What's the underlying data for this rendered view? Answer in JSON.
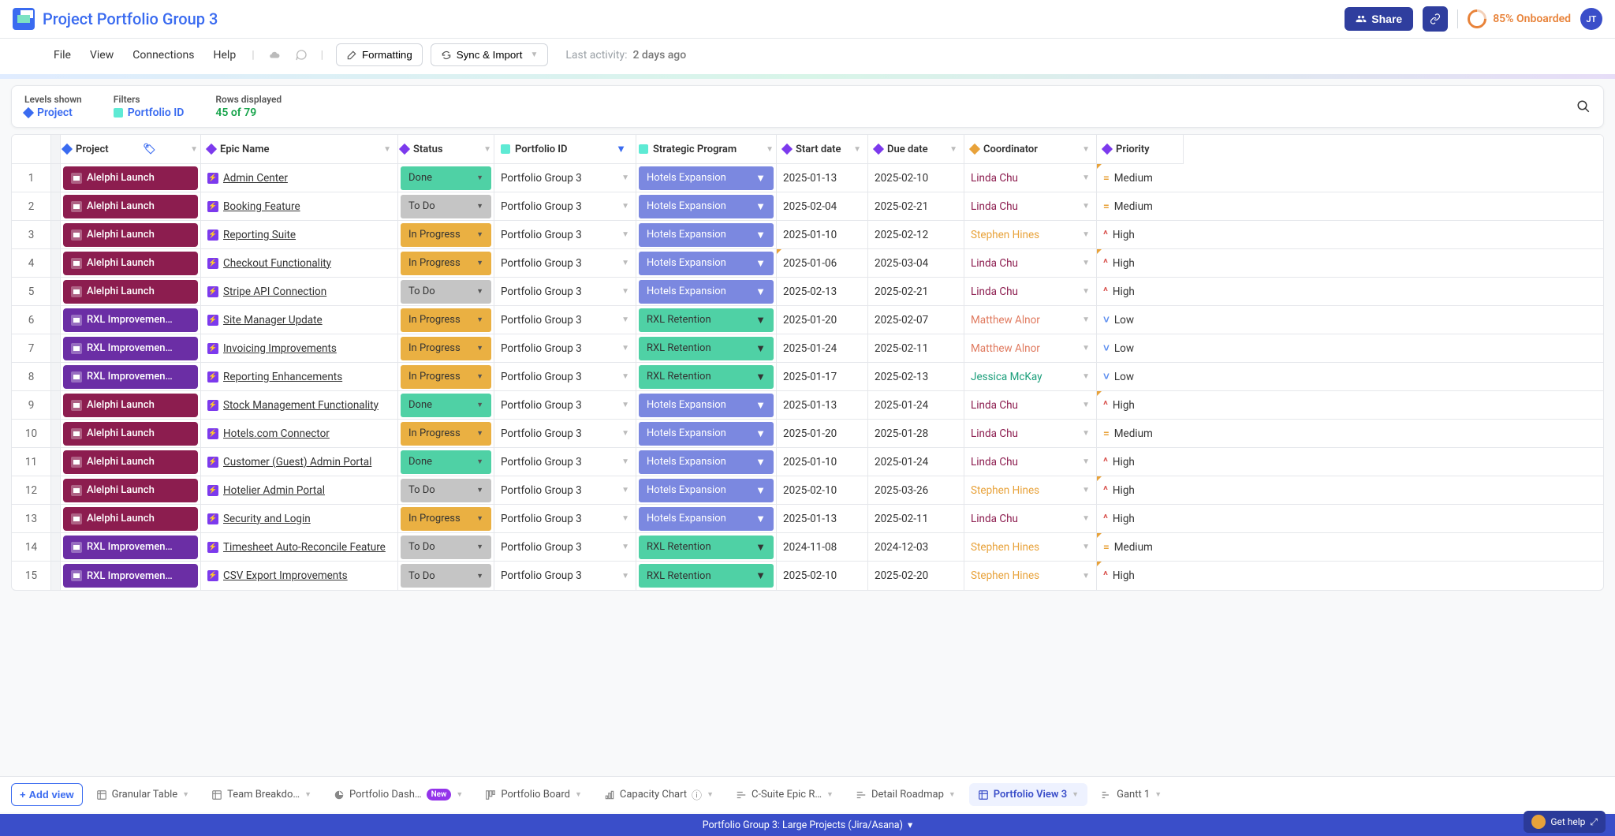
{
  "header": {
    "title": "Project Portfolio Group 3",
    "share_label": "Share",
    "onboard_label": "85% Onboarded",
    "avatar": "JT"
  },
  "menubar": {
    "file": "File",
    "view": "View",
    "connections": "Connections",
    "help": "Help",
    "formatting": "Formatting",
    "sync": "Sync & Import",
    "activity_prefix": "Last activity:",
    "activity_value": "2 days ago"
  },
  "infobar": {
    "levels_label": "Levels shown",
    "levels_value": "Project",
    "filters_label": "Filters",
    "filters_value": "Portfolio ID",
    "rows_label": "Rows displayed",
    "rows_value": "45 of 79"
  },
  "columns": {
    "project": "Project",
    "epic": "Epic Name",
    "status": "Status",
    "portfolio": "Portfolio ID",
    "strategic": "Strategic Program",
    "start": "Start date",
    "due": "Due date",
    "coord": "Coordinator",
    "prio": "Priority"
  },
  "rows": [
    {
      "n": 1,
      "project": "Alelphi Launch",
      "projType": "alelphi",
      "epic": "Admin Center",
      "status": "Done",
      "portfolio": "Portfolio Group 3",
      "strategic": "Hotels Expansion",
      "stratType": "hotels",
      "start": "2025-01-13",
      "due": "2025-02-10",
      "coord": "Linda Chu",
      "coordType": "linda",
      "prio": "Medium",
      "startMark": false,
      "prioMark": true
    },
    {
      "n": 2,
      "project": "Alelphi Launch",
      "projType": "alelphi",
      "epic": "Booking Feature",
      "status": "To Do",
      "portfolio": "Portfolio Group 3",
      "strategic": "Hotels Expansion",
      "stratType": "hotels",
      "start": "2025-02-04",
      "due": "2025-02-21",
      "coord": "Linda Chu",
      "coordType": "linda",
      "prio": "Medium",
      "startMark": false,
      "prioMark": false
    },
    {
      "n": 3,
      "project": "Alelphi Launch",
      "projType": "alelphi",
      "epic": "Reporting Suite",
      "status": "In Progress",
      "portfolio": "Portfolio Group 3",
      "strategic": "Hotels Expansion",
      "stratType": "hotels",
      "start": "2025-01-10",
      "due": "2025-02-12",
      "coord": "Stephen Hines",
      "coordType": "stephen",
      "prio": "High",
      "startMark": false,
      "prioMark": false
    },
    {
      "n": 4,
      "project": "Alelphi Launch",
      "projType": "alelphi",
      "epic": "Checkout Functionality",
      "status": "In Progress",
      "portfolio": "Portfolio Group 3",
      "strategic": "Hotels Expansion",
      "stratType": "hotels",
      "start": "2025-01-06",
      "due": "2025-03-04",
      "coord": "Linda Chu",
      "coordType": "linda",
      "prio": "High",
      "startMark": true,
      "prioMark": true
    },
    {
      "n": 5,
      "project": "Alelphi Launch",
      "projType": "alelphi",
      "epic": "Stripe API Connection",
      "status": "To Do",
      "portfolio": "Portfolio Group 3",
      "strategic": "Hotels Expansion",
      "stratType": "hotels",
      "start": "2025-02-13",
      "due": "2025-02-21",
      "coord": "Linda Chu",
      "coordType": "linda",
      "prio": "High",
      "startMark": false,
      "prioMark": false
    },
    {
      "n": 6,
      "project": "RXL Improvemen…",
      "projType": "rxl",
      "epic": "Site Manager Update",
      "status": "In Progress",
      "portfolio": "Portfolio Group 3",
      "strategic": "RXL Retention",
      "stratType": "rxl",
      "start": "2025-01-20",
      "due": "2025-02-07",
      "coord": "Matthew Alnor",
      "coordType": "matthew",
      "prio": "Low",
      "startMark": false,
      "prioMark": false
    },
    {
      "n": 7,
      "project": "RXL Improvemen…",
      "projType": "rxl",
      "epic": "Invoicing Improvements",
      "status": "In Progress",
      "portfolio": "Portfolio Group 3",
      "strategic": "RXL Retention",
      "stratType": "rxl",
      "start": "2025-01-24",
      "due": "2025-02-11",
      "coord": "Matthew Alnor",
      "coordType": "matthew",
      "prio": "Low",
      "startMark": false,
      "prioMark": false
    },
    {
      "n": 8,
      "project": "RXL Improvemen…",
      "projType": "rxl",
      "epic": "Reporting Enhancements",
      "status": "In Progress",
      "portfolio": "Portfolio Group 3",
      "strategic": "RXL Retention",
      "stratType": "rxl",
      "start": "2025-01-17",
      "due": "2025-02-13",
      "coord": "Jessica McKay",
      "coordType": "jessica",
      "prio": "Low",
      "startMark": false,
      "prioMark": false
    },
    {
      "n": 9,
      "project": "Alelphi Launch",
      "projType": "alelphi",
      "epic": "Stock Management Functionality",
      "status": "Done",
      "portfolio": "Portfolio Group 3",
      "strategic": "Hotels Expansion",
      "stratType": "hotels",
      "start": "2025-01-13",
      "due": "2025-01-24",
      "coord": "Linda Chu",
      "coordType": "linda",
      "prio": "High",
      "startMark": false,
      "prioMark": true
    },
    {
      "n": 10,
      "project": "Alelphi Launch",
      "projType": "alelphi",
      "epic": "Hotels.com Connector",
      "status": "In Progress",
      "portfolio": "Portfolio Group 3",
      "strategic": "Hotels Expansion",
      "stratType": "hotels",
      "start": "2025-01-20",
      "due": "2025-01-28",
      "coord": "Linda Chu",
      "coordType": "linda",
      "prio": "Medium",
      "startMark": false,
      "prioMark": false
    },
    {
      "n": 11,
      "project": "Alelphi Launch",
      "projType": "alelphi",
      "epic": "Customer (Guest) Admin Portal",
      "status": "Done",
      "portfolio": "Portfolio Group 3",
      "strategic": "Hotels Expansion",
      "stratType": "hotels",
      "start": "2025-01-10",
      "due": "2025-01-24",
      "coord": "Linda Chu",
      "coordType": "linda",
      "prio": "High",
      "startMark": false,
      "prioMark": false
    },
    {
      "n": 12,
      "project": "Alelphi Launch",
      "projType": "alelphi",
      "epic": "Hotelier Admin Portal",
      "status": "To Do",
      "portfolio": "Portfolio Group 3",
      "strategic": "Hotels Expansion",
      "stratType": "hotels",
      "start": "2025-02-10",
      "due": "2025-03-26",
      "coord": "Stephen Hines",
      "coordType": "stephen",
      "prio": "High",
      "startMark": false,
      "prioMark": true
    },
    {
      "n": 13,
      "project": "Alelphi Launch",
      "projType": "alelphi",
      "epic": "Security and Login",
      "status": "In Progress",
      "portfolio": "Portfolio Group 3",
      "strategic": "Hotels Expansion",
      "stratType": "hotels",
      "start": "2025-01-13",
      "due": "2025-02-11",
      "coord": "Linda Chu",
      "coordType": "linda",
      "prio": "High",
      "startMark": false,
      "prioMark": false
    },
    {
      "n": 14,
      "project": "RXL Improvemen…",
      "projType": "rxl",
      "epic": "Timesheet Auto-Reconcile Feature",
      "status": "To Do",
      "portfolio": "Portfolio Group 3",
      "strategic": "RXL Retention",
      "stratType": "rxl",
      "start": "2024-11-08",
      "due": "2024-12-03",
      "coord": "Stephen Hines",
      "coordType": "stephen",
      "prio": "Medium",
      "startMark": false,
      "prioMark": true
    },
    {
      "n": 15,
      "project": "RXL Improvemen…",
      "projType": "rxl",
      "epic": "CSV Export Improvements",
      "status": "To Do",
      "portfolio": "Portfolio Group 3",
      "strategic": "RXL Retention",
      "stratType": "rxl",
      "start": "2025-02-10",
      "due": "2025-02-20",
      "coord": "Stephen Hines",
      "coordType": "stephen",
      "prio": "High",
      "startMark": false,
      "prioMark": true
    }
  ],
  "tabs": {
    "addview": "Add view",
    "granular": "Granular Table",
    "team": "Team Breakdo…",
    "dash": "Portfolio Dash…",
    "new": "New",
    "board": "Portfolio Board",
    "capacity": "Capacity Chart",
    "csuite": "C-Suite Epic R…",
    "roadmap": "Detail Roadmap",
    "pview3": "Portfolio View 3",
    "gantt": "Gantt 1"
  },
  "footer": {
    "text": "Portfolio Group 3: Large Projects (Jira/Asana)",
    "help": "Get help"
  },
  "status_map": {
    "Done": "status-done",
    "To Do": "status-todo",
    "In Progress": "status-prog"
  },
  "prio_map": {
    "Medium": {
      "cls": "prio-med",
      "icon": "="
    },
    "High": {
      "cls": "prio-high",
      "icon": "^"
    },
    "Low": {
      "cls": "prio-low",
      "icon": "˅"
    }
  }
}
